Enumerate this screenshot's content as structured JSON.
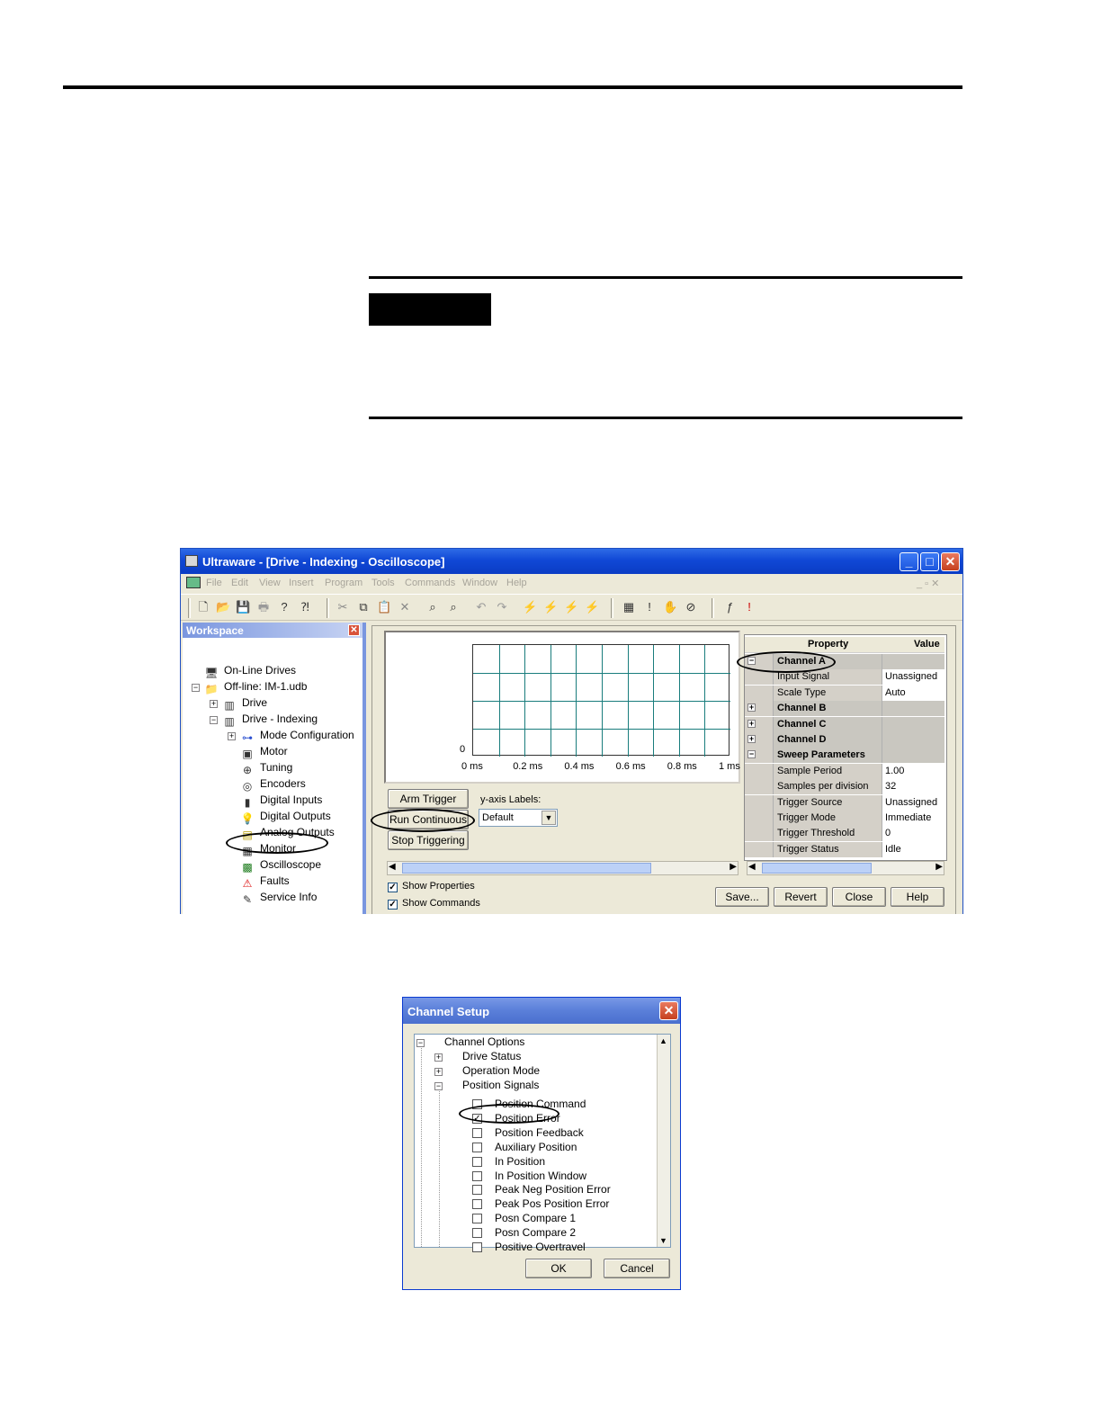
{
  "window": {
    "title": "Ultraware - [Drive - Indexing - Oscilloscope]",
    "menu": [
      "File",
      "Edit",
      "View",
      "Insert",
      "Program",
      "Tools",
      "Commands",
      "Window",
      "Help"
    ]
  },
  "workspace": {
    "title": "Workspace",
    "tree": [
      {
        "label": "On-Line Drives",
        "icon": "online-drives-icon"
      },
      {
        "label": "Off-line: IM-1.udb",
        "icon": "folder-icon"
      },
      {
        "label": "Drive",
        "icon": "drive-icon"
      },
      {
        "label": "Drive - Indexing",
        "icon": "drive-icon"
      },
      {
        "label": "Mode Configuration",
        "icon": "mode-configuration-icon"
      },
      {
        "label": "Motor",
        "icon": "motor-icon"
      },
      {
        "label": "Tuning",
        "icon": "tuning-icon"
      },
      {
        "label": "Encoders",
        "icon": "encoder-icon"
      },
      {
        "label": "Digital Inputs",
        "icon": "digital-inputs-icon"
      },
      {
        "label": "Digital Outputs",
        "icon": "lightbulb-icon"
      },
      {
        "label": "Analog Outputs",
        "icon": "analog-outputs-icon"
      },
      {
        "label": "Monitor",
        "icon": "monitor-icon"
      },
      {
        "label": "Oscilloscope",
        "icon": "oscilloscope-icon"
      },
      {
        "label": "Faults",
        "icon": "warning-icon"
      },
      {
        "label": "Service Info",
        "icon": "service-info-icon"
      }
    ]
  },
  "scope": {
    "y_zero": "0",
    "x_ticks": [
      "0 ms",
      "0.2 ms",
      "0.4 ms",
      "0.6 ms",
      "0.8 ms",
      "1 ms"
    ],
    "grid_color": "#197d7d",
    "buttons": {
      "arm": "Arm Trigger",
      "run": "Run Continuous",
      "stop": "Stop Triggering"
    },
    "yaxis_label": "y-axis Labels:",
    "yaxis_value": "Default",
    "show_properties": "Show Properties",
    "show_commands": "Show Commands"
  },
  "properties": {
    "headers": {
      "property": "Property",
      "value": "Value"
    },
    "rows": [
      {
        "k": "Channel A",
        "v": "",
        "cat": true,
        "sign": "−"
      },
      {
        "k": "Input Signal",
        "v": "Unassigned"
      },
      {
        "k": "Scale Type",
        "v": "Auto"
      },
      {
        "k": "Channel B",
        "v": "",
        "cat": true,
        "sign": "+"
      },
      {
        "k": "Channel C",
        "v": "",
        "cat": true,
        "sign": "+"
      },
      {
        "k": "Channel D",
        "v": "",
        "cat": true,
        "sign": "+"
      },
      {
        "k": "Sweep Parameters",
        "v": "",
        "cat": true,
        "sign": "−"
      },
      {
        "k": "Sample Period",
        "v": "1.00"
      },
      {
        "k": "Samples per division",
        "v": "32"
      },
      {
        "k": "Trigger Source",
        "v": "Unassigned"
      },
      {
        "k": "Trigger Mode",
        "v": "Immediate"
      },
      {
        "k": "Trigger Threshold",
        "v": "0"
      },
      {
        "k": "Trigger Status",
        "v": "Idle"
      }
    ]
  },
  "footer_buttons": {
    "save": "Save...",
    "revert": "Revert",
    "close": "Close",
    "help": "Help"
  },
  "dialog": {
    "title": "Channel Setup",
    "root": "Channel Options",
    "groups": [
      "Drive Status",
      "Operation Mode",
      "Position Signals"
    ],
    "items": [
      {
        "label": "Position Command",
        "checked": false
      },
      {
        "label": "Position Error",
        "checked": true
      },
      {
        "label": "Position Feedback",
        "checked": false
      },
      {
        "label": "Auxiliary Position",
        "checked": false
      },
      {
        "label": "In Position",
        "checked": false
      },
      {
        "label": "In Position Window",
        "checked": false
      },
      {
        "label": "Peak Neg Position Error",
        "checked": false
      },
      {
        "label": "Peak Pos Position Error",
        "checked": false
      },
      {
        "label": "Posn Compare 1",
        "checked": false
      },
      {
        "label": "Posn Compare 2",
        "checked": false
      },
      {
        "label": "Positive Overtravel",
        "checked": false
      }
    ],
    "ok": "OK",
    "cancel": "Cancel"
  }
}
